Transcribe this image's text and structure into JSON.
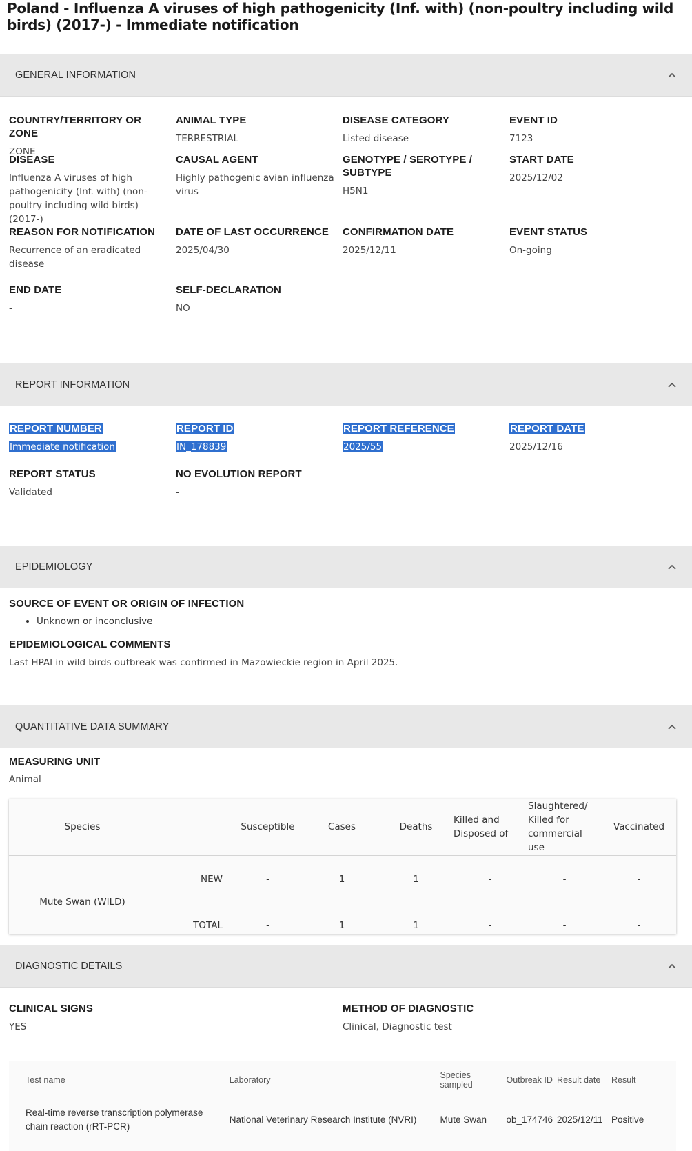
{
  "page_title": "Poland - Influenza A viruses of high pathogenicity (Inf. with) (non-poultry including wild birds) (2017-) - Immediate notification",
  "general_information": {
    "header": "GENERAL INFORMATION",
    "fields": [
      {
        "label": "COUNTRY/TERRITORY OR ZONE",
        "value": "ZONE"
      },
      {
        "label": "ANIMAL TYPE",
        "value": "TERRESTRIAL"
      },
      {
        "label": "DISEASE CATEGORY",
        "value": "Listed disease"
      },
      {
        "label": "EVENT ID",
        "value": "7123"
      },
      {
        "label": "DISEASE",
        "value": "Influenza A viruses of high pathogenicity (Inf. with) (non-poultry including wild birds) (2017-)"
      },
      {
        "label": "CAUSAL AGENT",
        "value": "Highly pathogenic avian influenza virus"
      },
      {
        "label": "GENOTYPE / SEROTYPE / SUBTYPE",
        "value": "H5N1"
      },
      {
        "label": "START DATE",
        "value": "2025/12/02"
      },
      {
        "label": "REASON FOR NOTIFICATION",
        "value": "Recurrence of an eradicated disease"
      },
      {
        "label": "DATE OF LAST OCCURRENCE",
        "value": "2025/04/30"
      },
      {
        "label": "CONFIRMATION DATE",
        "value": "2025/12/11"
      },
      {
        "label": "EVENT STATUS",
        "value": "On-going"
      },
      {
        "label": "END DATE",
        "value": "-"
      },
      {
        "label": "SELF-DECLARATION",
        "value": "NO"
      }
    ]
  },
  "report_information": {
    "header": "REPORT INFORMATION",
    "fields": [
      {
        "label": "REPORT NUMBER",
        "value": "Immediate notification"
      },
      {
        "label": "REPORT ID",
        "value": "IN_178839"
      },
      {
        "label": "REPORT REFERENCE",
        "value": "2025/55"
      },
      {
        "label": "REPORT DATE",
        "value": "2025/12/16"
      },
      {
        "label": "REPORT STATUS",
        "value": "Validated"
      },
      {
        "label": "NO EVOLUTION REPORT",
        "value": "-"
      }
    ]
  },
  "epidemiology": {
    "header": "EPIDEMIOLOGY",
    "source_label": "SOURCE OF EVENT OR ORIGIN OF INFECTION",
    "sources": [
      "Unknown or inconclusive"
    ],
    "comments_label": "EPIDEMIOLOGICAL COMMENTS",
    "comments": "Last HPAI in wild birds outbreak was confirmed in Mazowieckie region in April 2025."
  },
  "quantitative": {
    "header": "QUANTITATIVE DATA SUMMARY",
    "unit_label": "MEASURING UNIT",
    "unit_value": "Animal",
    "columns": {
      "species": "Species",
      "susceptible": "Susceptible",
      "cases": "Cases",
      "deaths": "Deaths",
      "killed": "Killed and Disposed of",
      "slaughtered": "Slaughtered/ Killed for commercial use",
      "vaccinated": "Vaccinated"
    },
    "species": "Mute Swan (WILD)",
    "rows": [
      {
        "kind": "NEW",
        "susceptible": "-",
        "cases": "1",
        "deaths": "1",
        "killed": "-",
        "slaughtered": "-",
        "vaccinated": "-"
      },
      {
        "kind": "TOTAL",
        "susceptible": "-",
        "cases": "1",
        "deaths": "1",
        "killed": "-",
        "slaughtered": "-",
        "vaccinated": "-"
      }
    ]
  },
  "diagnostic": {
    "header": "DIAGNOSTIC DETAILS",
    "clinical_label": "CLINICAL SIGNS",
    "clinical_value": "YES",
    "method_label": "METHOD OF DIAGNOSTIC",
    "method_value": "Clinical, Diagnostic test",
    "columns": {
      "test_name": "Test name",
      "laboratory": "Laboratory",
      "species_sampled": "Species sampled",
      "outbreak_id": "Outbreak ID",
      "result_date": "Result date",
      "result": "Result"
    },
    "row": {
      "test_name": "Real-time reverse transcription polymerase chain reaction (rRT-PCR)",
      "laboratory": "National Veterinary Research Institute (NVRI)",
      "species_sampled": "Mute Swan",
      "outbreak_id": "ob_174746",
      "result_date": "2025/12/11",
      "result": "Positive"
    }
  }
}
